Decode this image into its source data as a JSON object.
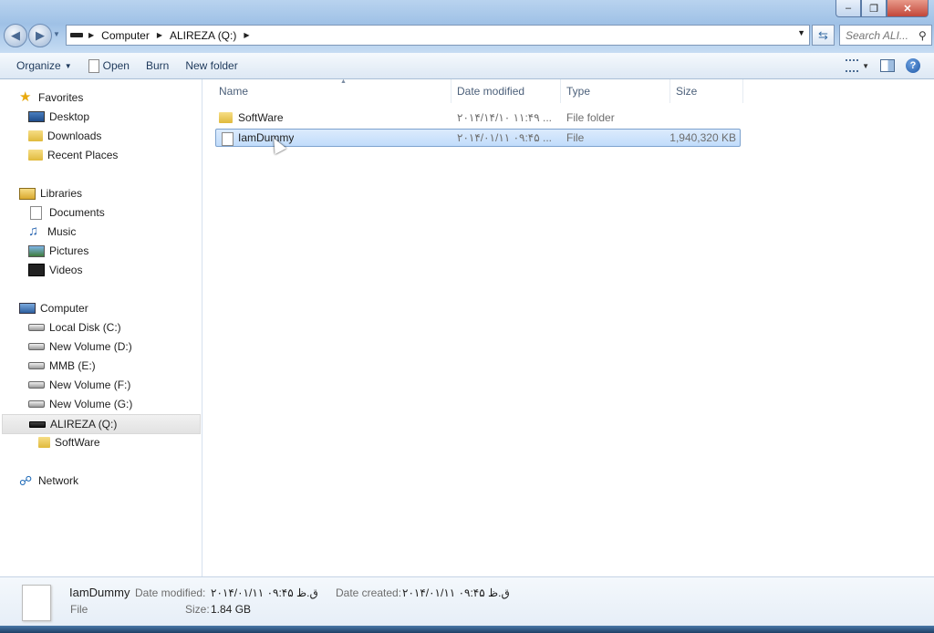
{
  "window": {
    "min_glyph": "–",
    "max_glyph": "❐",
    "close_glyph": "✕"
  },
  "address": {
    "crumbs": [
      "Computer",
      "ALIREZA (Q:)"
    ],
    "search_placeholder": "Search ALI..."
  },
  "toolbar": {
    "organize": "Organize",
    "open": "Open",
    "burn": "Burn",
    "new_folder": "New folder"
  },
  "nav": {
    "favorites": "Favorites",
    "desktop": "Desktop",
    "downloads": "Downloads",
    "recent_places": "Recent Places",
    "libraries": "Libraries",
    "documents": "Documents",
    "music": "Music",
    "pictures": "Pictures",
    "videos": "Videos",
    "computer": "Computer",
    "drives": [
      "Local Disk (C:)",
      "New Volume (D:)",
      "MMB (E:)",
      "New Volume (F:)",
      "New Volume (G:)"
    ],
    "selected_drive": "ALIREZA (Q:)",
    "subfolder": "SoftWare",
    "network": "Network"
  },
  "columns": {
    "name": "Name",
    "date_modified": "Date modified",
    "type": "Type",
    "size": "Size"
  },
  "files": [
    {
      "name": "SoftWare",
      "date": "۲۰۱۴/۱۴/۱۰ ۱۱:۴۹ ...",
      "type": "File folder",
      "size": ""
    },
    {
      "name": "IamDummy",
      "date": "۲۰۱۴/۰۱/۱۱ ۰۹:۴۵ ...",
      "type": "File",
      "size": "1,940,320 KB"
    }
  ],
  "details": {
    "name": "IamDummy",
    "type": "File",
    "date_modified_label": "Date modified:",
    "date_modified": "۲۰۱۴/۰۱/۱۱ ق.ظ ۰۹:۴۵",
    "date_created_label": "Date created:",
    "date_created": "۲۰۱۴/۰۱/۱۱ ق.ظ ۰۹:۴۵",
    "size_label": "Size:",
    "size": "1.84 GB"
  }
}
